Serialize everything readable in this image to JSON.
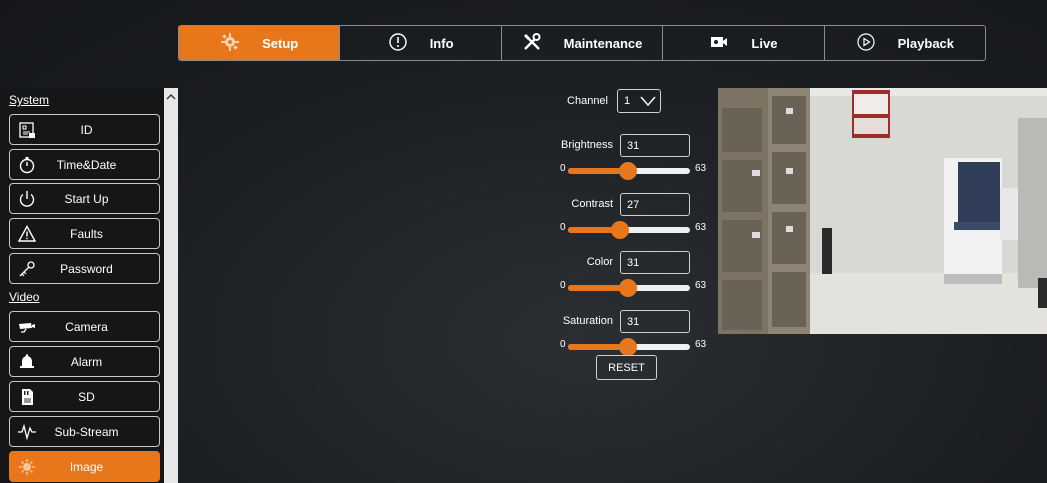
{
  "nav": {
    "tabs": [
      {
        "label": "Setup",
        "icon": "gear-icon",
        "active": true
      },
      {
        "label": "Info",
        "icon": "info-icon",
        "active": false
      },
      {
        "label": "Maintenance",
        "icon": "tools-icon",
        "active": false
      },
      {
        "label": "Live",
        "icon": "camera-live-icon",
        "active": false
      },
      {
        "label": "Playback",
        "icon": "play-circle-icon",
        "active": false
      }
    ]
  },
  "sidebar": {
    "system_title": "System",
    "video_title": "Video",
    "system_items": [
      {
        "label": "ID",
        "icon": "id-card-icon"
      },
      {
        "label": "Time&Date",
        "icon": "stopwatch-icon"
      },
      {
        "label": "Start Up",
        "icon": "power-icon"
      },
      {
        "label": "Faults",
        "icon": "warning-icon"
      },
      {
        "label": "Password",
        "icon": "key-icon"
      }
    ],
    "video_items": [
      {
        "label": "Camera",
        "icon": "camera-icon"
      },
      {
        "label": "Alarm",
        "icon": "bell-icon"
      },
      {
        "label": "SD",
        "icon": "sd-card-icon"
      },
      {
        "label": "Sub-Stream",
        "icon": "waveform-icon"
      },
      {
        "label": "Image",
        "icon": "image-gear-icon",
        "active": true
      }
    ]
  },
  "controls": {
    "channel_label": "Channel",
    "channel_value": "1",
    "min_label": "0",
    "max_label": "63",
    "sliders": [
      {
        "label": "Brightness",
        "value": "31",
        "fraction": 0.49
      },
      {
        "label": "Contrast",
        "value": "27",
        "fraction": 0.43
      },
      {
        "label": "Color",
        "value": "31",
        "fraction": 0.49
      },
      {
        "label": "Saturation",
        "value": "31",
        "fraction": 0.49
      }
    ],
    "reset_label": "RESET"
  },
  "colors": {
    "accent": "#e8761a",
    "background": "#1e2124"
  }
}
